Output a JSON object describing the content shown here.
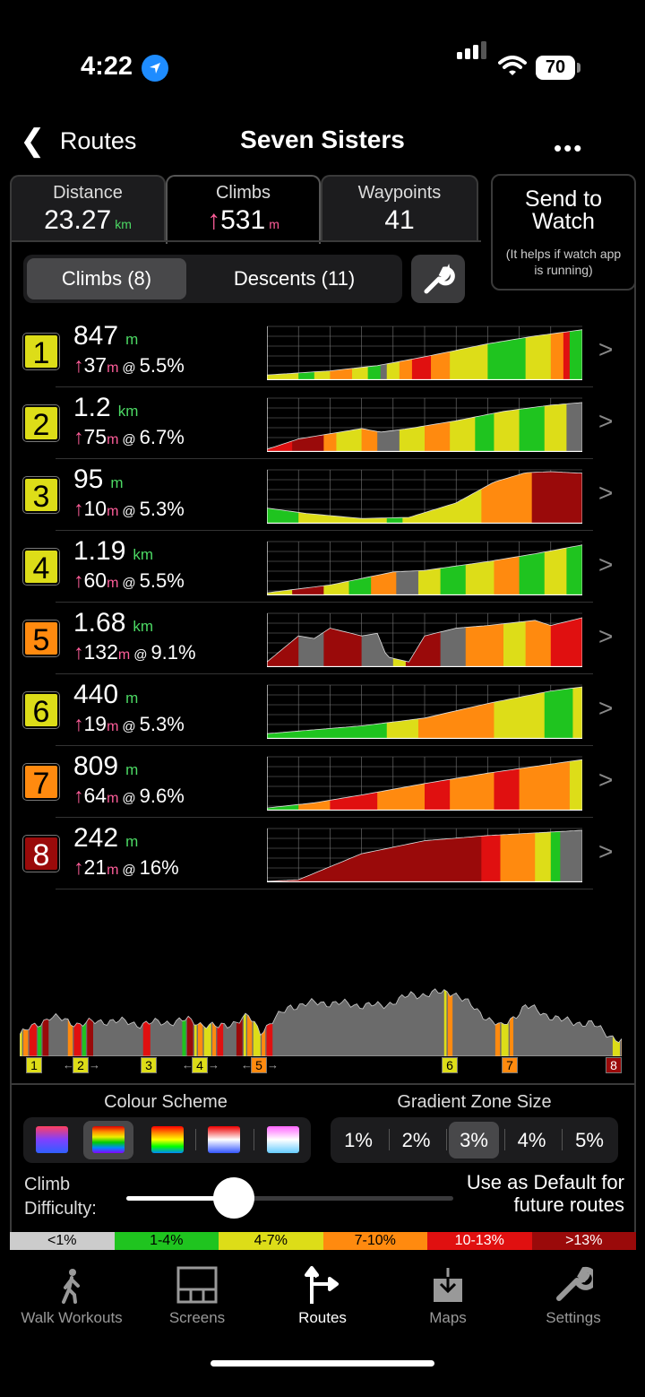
{
  "status": {
    "time": "4:22",
    "battery": "70"
  },
  "nav": {
    "back_label": "Routes",
    "title": "Seven Sisters",
    "more": "•••"
  },
  "tabs": {
    "distance": {
      "label": "Distance",
      "value": "23.27",
      "unit": "km"
    },
    "climbs": {
      "label": "Climbs",
      "value": "531",
      "unit": "m"
    },
    "waypoints": {
      "label": "Waypoints",
      "value": "41"
    }
  },
  "send": {
    "title": "Send to Watch",
    "note": "(It helps if watch app is running)"
  },
  "segment": {
    "climbs": "Climbs (8)",
    "descents": "Descents (11)"
  },
  "colors": {
    "grey": "#6b6b6b",
    "green": "#1fc41f",
    "yellow": "#dddd18",
    "orange": "#ff8a0f",
    "red": "#e01010",
    "maroon": "#9a0a0a"
  },
  "climbs": [
    {
      "num": "1",
      "badge": "yellow",
      "dist": "847",
      "dist_unit": "m",
      "gain": "37",
      "gain_unit": "m",
      "at": "@",
      "grade": "5.5%",
      "profile": [
        [
          0,
          0.1
        ],
        [
          0.2,
          0.18
        ],
        [
          0.35,
          0.28
        ],
        [
          0.5,
          0.45
        ],
        [
          0.7,
          0.7
        ],
        [
          0.85,
          0.85
        ],
        [
          1,
          0.97
        ]
      ],
      "bands": [
        [
          0,
          0.1,
          "yellow"
        ],
        [
          0.1,
          0.15,
          "green"
        ],
        [
          0.15,
          0.2,
          "yellow"
        ],
        [
          0.2,
          0.27,
          "orange"
        ],
        [
          0.27,
          0.32,
          "yellow"
        ],
        [
          0.32,
          0.36,
          "green"
        ],
        [
          0.36,
          0.38,
          "grey"
        ],
        [
          0.38,
          0.42,
          "yellow"
        ],
        [
          0.42,
          0.46,
          "orange"
        ],
        [
          0.46,
          0.52,
          "red"
        ],
        [
          0.52,
          0.58,
          "orange"
        ],
        [
          0.58,
          0.7,
          "yellow"
        ],
        [
          0.7,
          0.82,
          "green"
        ],
        [
          0.82,
          0.9,
          "yellow"
        ],
        [
          0.9,
          0.94,
          "orange"
        ],
        [
          0.94,
          0.96,
          "red"
        ],
        [
          0.96,
          1,
          "green"
        ]
      ]
    },
    {
      "num": "2",
      "badge": "yellow",
      "dist": "1.2",
      "dist_unit": "km",
      "gain": "75",
      "gain_unit": "m",
      "at": "@",
      "grade": "6.7%",
      "profile": [
        [
          0,
          0.05
        ],
        [
          0.1,
          0.25
        ],
        [
          0.2,
          0.35
        ],
        [
          0.3,
          0.45
        ],
        [
          0.36,
          0.38
        ],
        [
          0.45,
          0.45
        ],
        [
          0.6,
          0.6
        ],
        [
          0.75,
          0.78
        ],
        [
          0.9,
          0.9
        ],
        [
          1,
          0.95
        ]
      ],
      "bands": [
        [
          0,
          0.08,
          "red"
        ],
        [
          0.08,
          0.18,
          "maroon"
        ],
        [
          0.18,
          0.22,
          "orange"
        ],
        [
          0.22,
          0.3,
          "yellow"
        ],
        [
          0.3,
          0.35,
          "orange"
        ],
        [
          0.35,
          0.42,
          "grey"
        ],
        [
          0.42,
          0.5,
          "yellow"
        ],
        [
          0.5,
          0.58,
          "orange"
        ],
        [
          0.58,
          0.66,
          "yellow"
        ],
        [
          0.66,
          0.72,
          "green"
        ],
        [
          0.72,
          0.8,
          "yellow"
        ],
        [
          0.8,
          0.88,
          "green"
        ],
        [
          0.88,
          0.95,
          "yellow"
        ],
        [
          0.95,
          1,
          "grey"
        ]
      ]
    },
    {
      "num": "3",
      "badge": "yellow",
      "dist": "95",
      "dist_unit": "m",
      "gain": "10",
      "gain_unit": "m",
      "at": "@",
      "grade": "5.3%",
      "profile": [
        [
          0,
          0.3
        ],
        [
          0.12,
          0.2
        ],
        [
          0.3,
          0.1
        ],
        [
          0.45,
          0.12
        ],
        [
          0.6,
          0.4
        ],
        [
          0.72,
          0.8
        ],
        [
          0.82,
          0.98
        ],
        [
          0.9,
          1.0
        ],
        [
          1,
          0.97
        ]
      ],
      "bands": [
        [
          0,
          0.1,
          "green"
        ],
        [
          0.1,
          0.38,
          "yellow"
        ],
        [
          0.38,
          0.43,
          "green"
        ],
        [
          0.43,
          0.68,
          "yellow"
        ],
        [
          0.68,
          0.84,
          "orange"
        ],
        [
          0.84,
          1,
          "maroon"
        ]
      ]
    },
    {
      "num": "4",
      "badge": "yellow",
      "dist": "1.19",
      "dist_unit": "km",
      "gain": "60",
      "gain_unit": "m",
      "at": "@",
      "grade": "5.5%",
      "profile": [
        [
          0,
          0.05
        ],
        [
          0.2,
          0.2
        ],
        [
          0.4,
          0.45
        ],
        [
          0.5,
          0.48
        ],
        [
          0.7,
          0.65
        ],
        [
          0.85,
          0.8
        ],
        [
          1,
          0.97
        ]
      ],
      "bands": [
        [
          0,
          0.08,
          "yellow"
        ],
        [
          0.08,
          0.18,
          "maroon"
        ],
        [
          0.18,
          0.26,
          "yellow"
        ],
        [
          0.26,
          0.33,
          "green"
        ],
        [
          0.33,
          0.41,
          "orange"
        ],
        [
          0.41,
          0.48,
          "grey"
        ],
        [
          0.48,
          0.55,
          "yellow"
        ],
        [
          0.55,
          0.63,
          "green"
        ],
        [
          0.63,
          0.72,
          "yellow"
        ],
        [
          0.72,
          0.8,
          "orange"
        ],
        [
          0.8,
          0.88,
          "green"
        ],
        [
          0.88,
          0.95,
          "yellow"
        ],
        [
          0.95,
          1,
          "green"
        ]
      ]
    },
    {
      "num": "5",
      "badge": "orange",
      "dist": "1.68",
      "dist_unit": "km",
      "gain": "132",
      "gain_unit": "m",
      "at": "@",
      "grade": "9.1%",
      "profile": [
        [
          0,
          0.1
        ],
        [
          0.1,
          0.6
        ],
        [
          0.15,
          0.55
        ],
        [
          0.2,
          0.75
        ],
        [
          0.3,
          0.6
        ],
        [
          0.35,
          0.65
        ],
        [
          0.38,
          0.2
        ],
        [
          0.45,
          0.1
        ],
        [
          0.5,
          0.6
        ],
        [
          0.6,
          0.75
        ],
        [
          0.7,
          0.8
        ],
        [
          0.85,
          0.9
        ],
        [
          0.9,
          0.8
        ],
        [
          1,
          0.95
        ]
      ],
      "bands": [
        [
          0,
          0.1,
          "maroon"
        ],
        [
          0.1,
          0.18,
          "grey"
        ],
        [
          0.18,
          0.3,
          "maroon"
        ],
        [
          0.3,
          0.4,
          "grey"
        ],
        [
          0.4,
          0.44,
          "yellow"
        ],
        [
          0.44,
          0.55,
          "maroon"
        ],
        [
          0.55,
          0.63,
          "grey"
        ],
        [
          0.63,
          0.75,
          "orange"
        ],
        [
          0.75,
          0.82,
          "yellow"
        ],
        [
          0.82,
          0.9,
          "orange"
        ],
        [
          0.9,
          1,
          "red"
        ]
      ]
    },
    {
      "num": "6",
      "badge": "yellow",
      "dist": "440",
      "dist_unit": "m",
      "gain": "19",
      "gain_unit": "m",
      "at": "@",
      "grade": "5.3%",
      "profile": [
        [
          0,
          0.1
        ],
        [
          0.3,
          0.25
        ],
        [
          0.5,
          0.4
        ],
        [
          0.7,
          0.68
        ],
        [
          0.9,
          0.92
        ],
        [
          1,
          1.0
        ]
      ],
      "bands": [
        [
          0,
          0.38,
          "green"
        ],
        [
          0.38,
          0.48,
          "yellow"
        ],
        [
          0.48,
          0.72,
          "orange"
        ],
        [
          0.72,
          0.88,
          "yellow"
        ],
        [
          0.88,
          0.97,
          "green"
        ],
        [
          0.97,
          1,
          "yellow"
        ]
      ]
    },
    {
      "num": "7",
      "badge": "orange",
      "dist": "809",
      "dist_unit": "m",
      "gain": "64",
      "gain_unit": "m",
      "at": "@",
      "grade": "9.6%",
      "profile": [
        [
          0,
          0.05
        ],
        [
          0.15,
          0.15
        ],
        [
          0.3,
          0.3
        ],
        [
          0.5,
          0.52
        ],
        [
          0.7,
          0.72
        ],
        [
          1,
          0.98
        ]
      ],
      "bands": [
        [
          0,
          0.1,
          "green"
        ],
        [
          0.1,
          0.2,
          "orange"
        ],
        [
          0.2,
          0.35,
          "red"
        ],
        [
          0.35,
          0.5,
          "orange"
        ],
        [
          0.5,
          0.58,
          "red"
        ],
        [
          0.58,
          0.72,
          "orange"
        ],
        [
          0.72,
          0.8,
          "red"
        ],
        [
          0.8,
          0.96,
          "orange"
        ],
        [
          0.96,
          1,
          "yellow"
        ]
      ]
    },
    {
      "num": "8",
      "badge": "maroon",
      "dist": "242",
      "dist_unit": "m",
      "gain": "21",
      "gain_unit": "m",
      "at": "@",
      "grade": "16%",
      "profile": [
        [
          0,
          0.02
        ],
        [
          0.1,
          0.05
        ],
        [
          0.3,
          0.55
        ],
        [
          0.5,
          0.8
        ],
        [
          0.7,
          0.9
        ],
        [
          1,
          1.0
        ]
      ],
      "bands": [
        [
          0,
          0.05,
          "red"
        ],
        [
          0.05,
          0.68,
          "maroon"
        ],
        [
          0.68,
          0.74,
          "red"
        ],
        [
          0.74,
          0.85,
          "orange"
        ],
        [
          0.85,
          0.9,
          "yellow"
        ],
        [
          0.9,
          0.93,
          "green"
        ],
        [
          0.93,
          1,
          "grey"
        ]
      ]
    }
  ],
  "overview": {
    "markers": [
      {
        "label": "1",
        "color": "yellow",
        "arrows": false
      },
      {
        "label": "2",
        "color": "yellow",
        "arrows": true
      },
      {
        "label": "3",
        "color": "yellow",
        "arrows": false
      },
      {
        "label": "4",
        "color": "yellow",
        "arrows": true
      },
      {
        "label": "5",
        "color": "orange",
        "arrows": true
      },
      {
        "label": "6",
        "color": "yellow",
        "arrows": false
      },
      {
        "label": "7",
        "color": "orange",
        "arrows": false
      },
      {
        "label": "8",
        "color": "maroon",
        "arrows": false
      }
    ],
    "profile": [
      [
        0,
        0.3
      ],
      [
        0.05,
        0.55
      ],
      [
        0.1,
        0.45
      ],
      [
        0.15,
        0.5
      ],
      [
        0.2,
        0.45
      ],
      [
        0.28,
        0.5
      ],
      [
        0.33,
        0.4
      ],
      [
        0.38,
        0.55
      ],
      [
        0.4,
        0.35
      ],
      [
        0.45,
        0.7
      ],
      [
        0.5,
        0.75
      ],
      [
        0.6,
        0.7
      ],
      [
        0.65,
        0.85
      ],
      [
        0.72,
        0.9
      ],
      [
        0.75,
        0.7
      ],
      [
        0.8,
        0.4
      ],
      [
        0.84,
        0.7
      ],
      [
        0.9,
        0.5
      ],
      [
        0.95,
        0.45
      ],
      [
        1,
        0.2
      ]
    ]
  },
  "colour_scheme": {
    "title": "Colour Scheme"
  },
  "gradient_zone": {
    "title": "Gradient Zone Size",
    "options": [
      "1%",
      "2%",
      "3%",
      "4%",
      "5%"
    ],
    "selected": "3%"
  },
  "difficulty": {
    "label": "Climb Difficulty:",
    "level": 0.33
  },
  "default_button": "Use as Default for future routes",
  "legend": [
    "<1%",
    "1-4%",
    "4-7%",
    "7-10%",
    "10-13%",
    ">13%"
  ],
  "tabbar": [
    "Walk Workouts",
    "Screens",
    "Routes",
    "Maps",
    "Settings"
  ]
}
